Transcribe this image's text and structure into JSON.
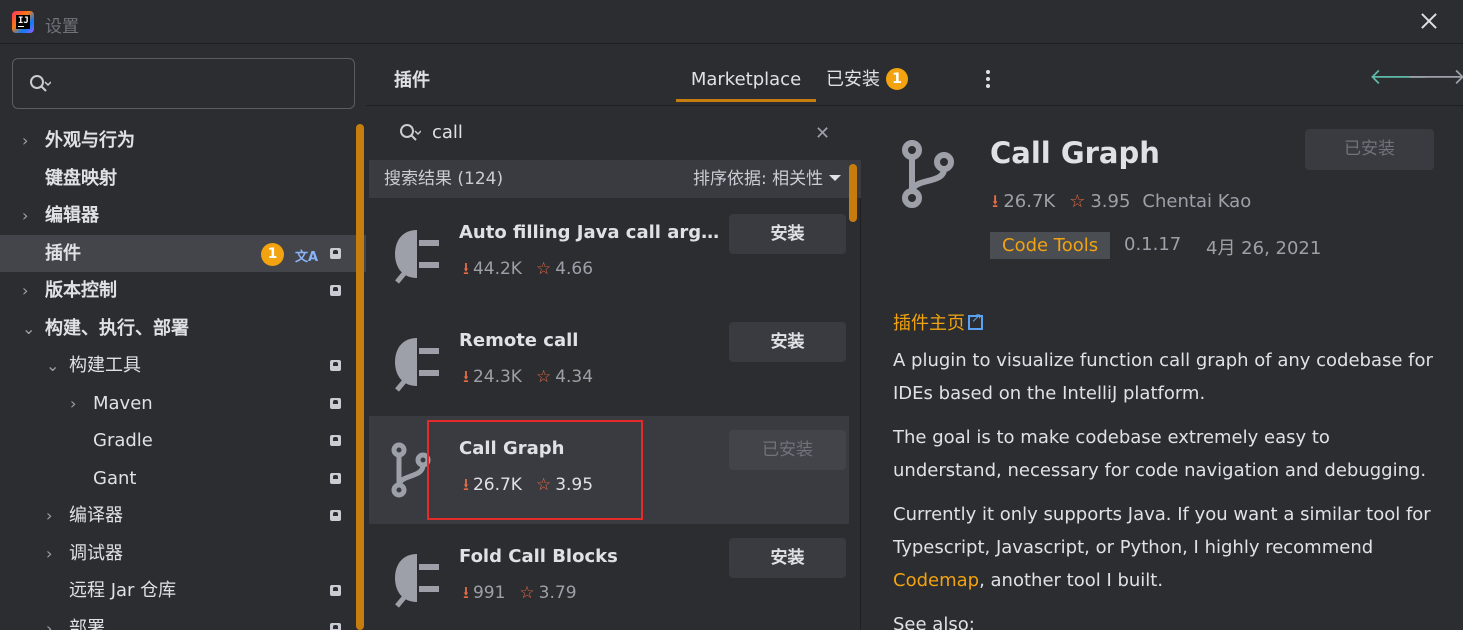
{
  "window": {
    "title": "设置"
  },
  "sidebar": {
    "search_placeholder": "",
    "items": [
      {
        "label": "外观与行为",
        "chevron": "›",
        "level": 0,
        "project": false
      },
      {
        "label": "键盘映射",
        "chevron": "",
        "level": 0,
        "project": false
      },
      {
        "label": "编辑器",
        "chevron": "›",
        "level": 0,
        "project": false
      },
      {
        "label": "插件",
        "chevron": "",
        "level": 0,
        "project": true,
        "selected": true,
        "badge": "1"
      },
      {
        "label": "版本控制",
        "chevron": "›",
        "level": 0,
        "project": true
      },
      {
        "label": "构建、执行、部署",
        "chevron": "⌄",
        "level": 0,
        "project": false
      },
      {
        "label": "构建工具",
        "chevron": "⌄",
        "level": 1,
        "project": true
      },
      {
        "label": "Maven",
        "chevron": "›",
        "level": 2,
        "project": true
      },
      {
        "label": "Gradle",
        "chevron": "",
        "level": 2,
        "project": true
      },
      {
        "label": "Gant",
        "chevron": "",
        "level": 2,
        "project": true
      },
      {
        "label": "编译器",
        "chevron": "›",
        "level": 1,
        "project": true
      },
      {
        "label": "调试器",
        "chevron": "›",
        "level": 1,
        "project": false
      },
      {
        "label": "远程 Jar 仓库",
        "chevron": "",
        "level": 1,
        "project": true
      },
      {
        "label": "部署",
        "chevron": "›",
        "level": 1,
        "project": true
      }
    ]
  },
  "header": {
    "title": "插件",
    "tab_marketplace": "Marketplace",
    "tab_installed": "已安装",
    "installed_count": "1"
  },
  "list": {
    "query": "call",
    "results_label": "搜索结果 (124)",
    "sort_label": "排序依据: 相关性",
    "plugins": [
      {
        "name": "Auto filling Java call argum…",
        "downloads": "44.2K",
        "rating": "4.66",
        "button": "安装",
        "icon": "plug-icon"
      },
      {
        "name": "Remote call",
        "downloads": "24.3K",
        "rating": "4.34",
        "button": "安装",
        "icon": "plug-icon"
      },
      {
        "name": "Call Graph",
        "downloads": "26.7K",
        "rating": "3.95",
        "button": "已安装",
        "icon": "branch-icon",
        "selected": true
      },
      {
        "name": "Fold Call Blocks",
        "downloads": "991",
        "rating": "3.79",
        "button": "安装",
        "icon": "plug-icon"
      }
    ]
  },
  "detail": {
    "name": "Call Graph",
    "installed_label": "已安装",
    "downloads": "26.7K",
    "rating": "3.95",
    "vendor": "Chentai Kao",
    "tag": "Code Tools",
    "version": "0.1.17",
    "date": "4月 26, 2021",
    "homepage_label": "插件主页",
    "desc_1": "A plugin to visualize function call graph of any codebase for IDEs based on the IntelliJ platform.",
    "desc_2": "The goal is to make codebase extremely easy to understand, necessary for code navigation and debugging.",
    "desc_3_before": "Currently it only supports Java. If you want a similar tool for Typescript, Javascript, or Python, I highly recommend ",
    "desc_3_link": "Codemap",
    "desc_3_after": ", another tool I built.",
    "see_also": "See also:"
  }
}
